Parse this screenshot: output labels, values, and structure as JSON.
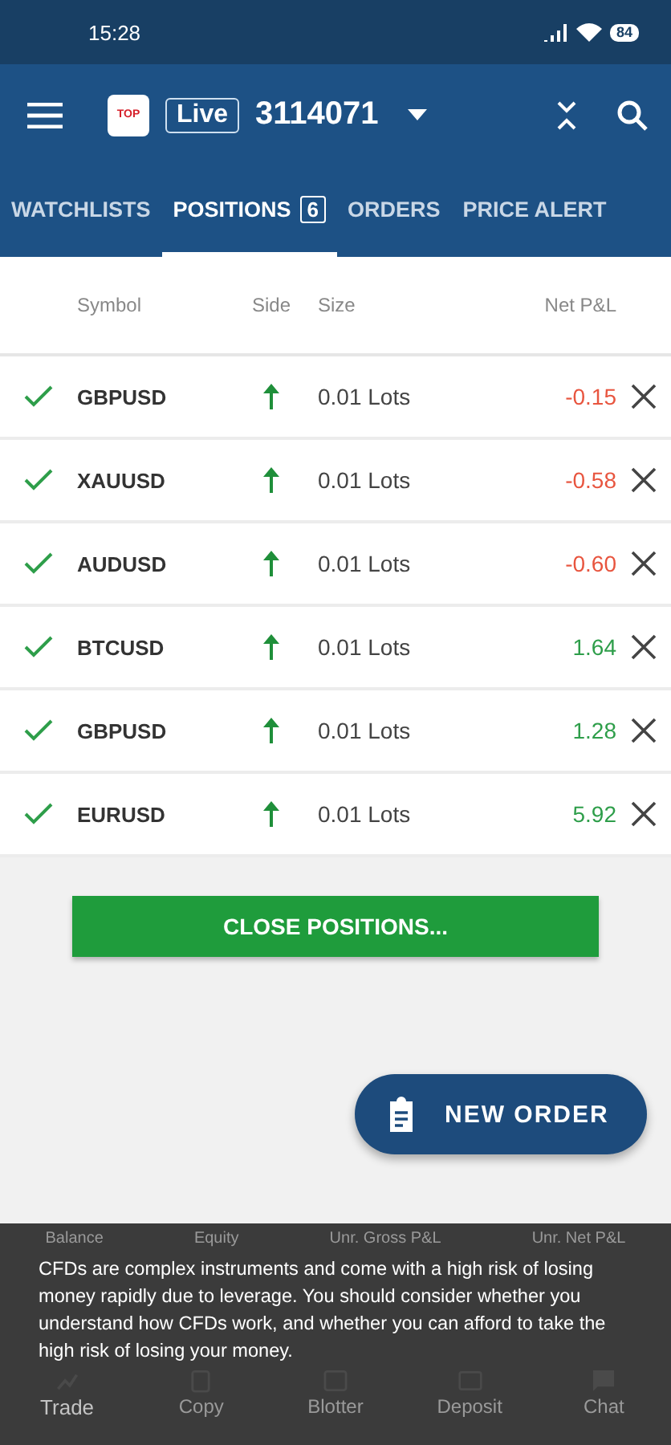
{
  "status_bar": {
    "time": "15:28",
    "battery": "84"
  },
  "header": {
    "logo": "TOP",
    "account_type": "Live",
    "account_number": "3114071"
  },
  "tabs": [
    {
      "label": "WATCHLISTS",
      "selected": false
    },
    {
      "label": "POSITIONS",
      "badge": "6",
      "selected": true
    },
    {
      "label": "ORDERS",
      "selected": false
    },
    {
      "label": "PRICE ALERT",
      "selected": false
    }
  ],
  "table": {
    "columns": [
      "Symbol",
      "Side",
      "Size",
      "Net P&L"
    ],
    "rows": [
      {
        "checked": true,
        "symbol": "GBPUSD",
        "size": "0.01 Lots",
        "pnl": "-0.15",
        "color": "#e8553f"
      },
      {
        "checked": true,
        "symbol": "XAUUSD",
        "size": "0.01 Lots",
        "pnl": "-0.58",
        "color": "#e8553f"
      },
      {
        "checked": true,
        "symbol": "AUDUSD",
        "size": "0.01 Lots",
        "pnl": "-0.60",
        "color": "#e8553f"
      },
      {
        "checked": true,
        "symbol": "BTCUSD",
        "size": "0.01 Lots",
        "pnl": "1.64",
        "color": "#2e9e4a"
      },
      {
        "checked": true,
        "symbol": "GBPUSD",
        "size": "0.01 Lots",
        "pnl": "1.28",
        "color": "#2e9e4a"
      },
      {
        "checked": true,
        "symbol": "EURUSD",
        "size": "0.01 Lots",
        "pnl": "5.92",
        "color": "#2e9e4a"
      }
    ]
  },
  "close_button": "CLOSE POSITIONS...",
  "fab": "NEW ORDER",
  "summary": [
    "Balance",
    "Equity",
    "Unr. Gross P&L",
    "Unr. Net P&L"
  ],
  "disclaimer": "CFDs are complex instruments and come with a high risk of losing money rapidly due to leverage. You should consider whether you understand how CFDs work, and whether you can afford to take the high risk of losing your money.",
  "nav": [
    {
      "label": "Trade",
      "selected": true
    },
    {
      "label": "Copy",
      "selected": false
    },
    {
      "label": "Blotter",
      "selected": false
    },
    {
      "label": "Deposit",
      "selected": false
    },
    {
      "label": "Chat",
      "selected": false
    }
  ]
}
